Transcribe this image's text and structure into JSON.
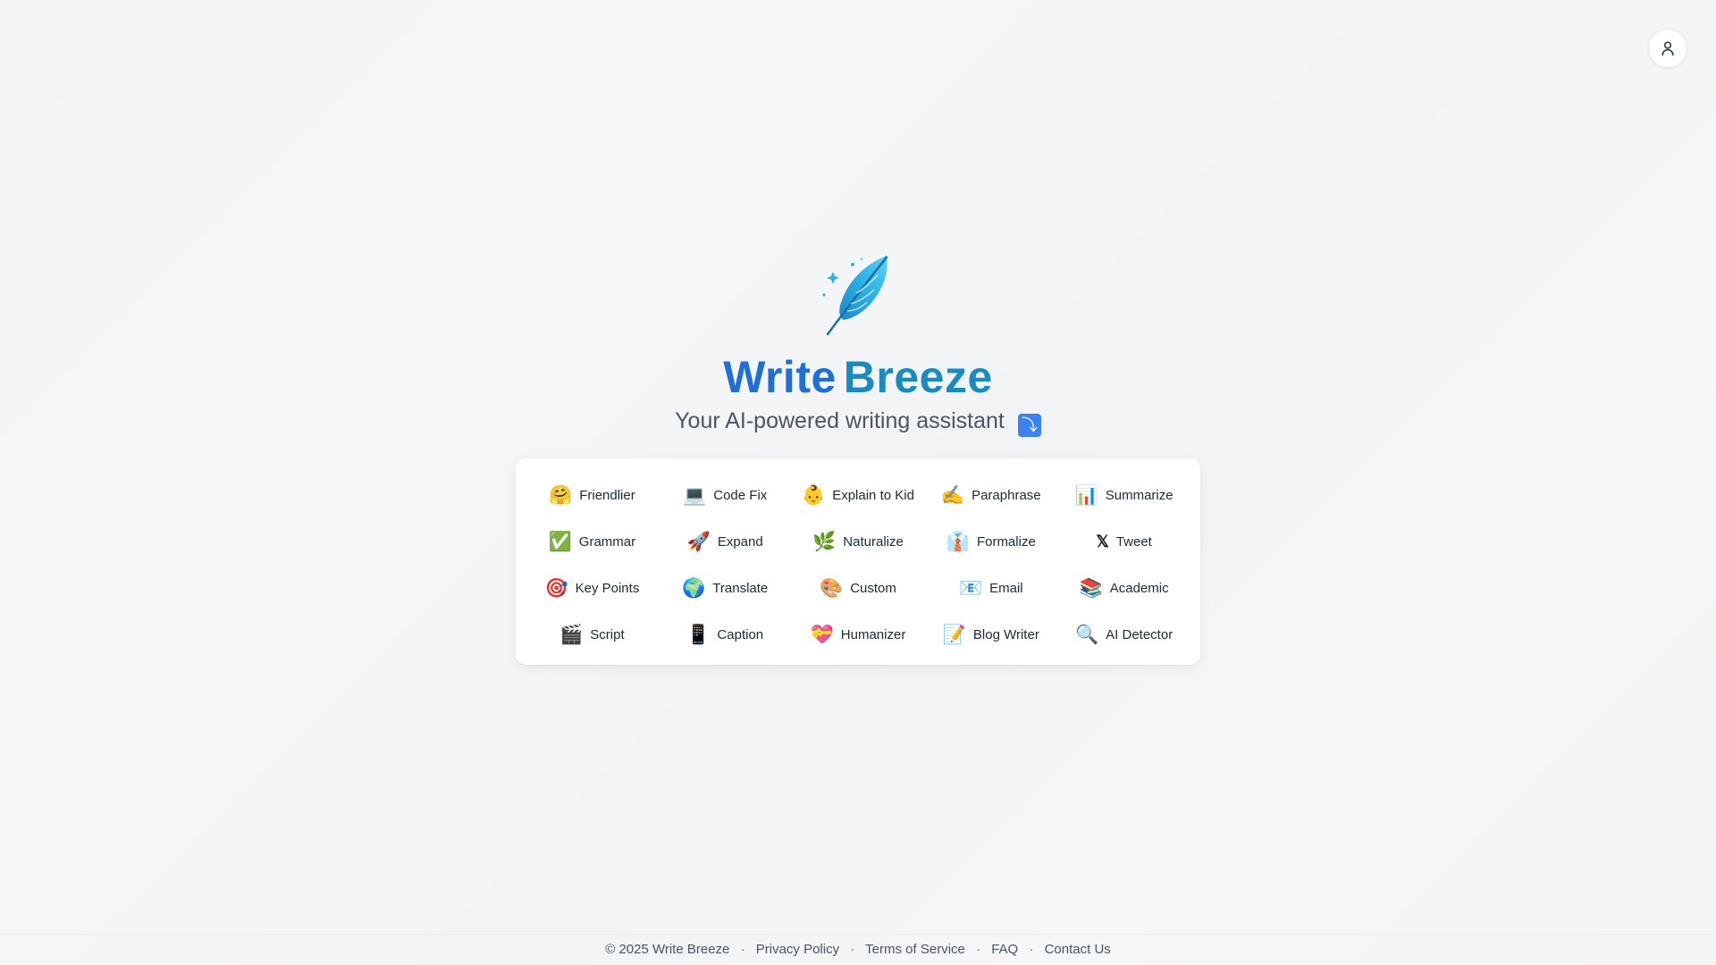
{
  "header": {
    "user_icon": "user-icon"
  },
  "brand": {
    "title_word1": "Write",
    "title_word2": "Breeze",
    "tagline": "Your AI-powered writing assistant",
    "tagline_icon": "arrow-curving-down-icon",
    "logo_icon": "feather-quill-icon",
    "title_colors": [
      "#1f6fd6",
      "#1a8bbf"
    ]
  },
  "tools": [
    {
      "label": "Friendlier",
      "emoji": "🤗",
      "icon": "hugging-face-icon"
    },
    {
      "label": "Code Fix",
      "emoji": "💻",
      "icon": "laptop-icon"
    },
    {
      "label": "Explain to Kid",
      "emoji": "👶",
      "icon": "baby-icon"
    },
    {
      "label": "Paraphrase",
      "emoji": "✍️",
      "icon": "writing-hand-icon"
    },
    {
      "label": "Summarize",
      "emoji": "📊",
      "icon": "bar-chart-icon"
    },
    {
      "label": "Grammar",
      "emoji": "✅",
      "icon": "check-mark-icon"
    },
    {
      "label": "Expand",
      "emoji": "🚀",
      "icon": "rocket-icon"
    },
    {
      "label": "Naturalize",
      "emoji": "🌿",
      "icon": "herb-icon"
    },
    {
      "label": "Formalize",
      "emoji": "👔",
      "icon": "necktie-icon"
    },
    {
      "label": "Tweet",
      "emoji": "𝕏",
      "icon": "x-logo-icon"
    },
    {
      "label": "Key Points",
      "emoji": "🎯",
      "icon": "target-icon"
    },
    {
      "label": "Translate",
      "emoji": "🌍",
      "icon": "globe-icon"
    },
    {
      "label": "Custom",
      "emoji": "🎨",
      "icon": "palette-icon"
    },
    {
      "label": "Email",
      "emoji": "📧",
      "icon": "email-icon"
    },
    {
      "label": "Academic",
      "emoji": "📚",
      "icon": "books-icon"
    },
    {
      "label": "Script",
      "emoji": "🎬",
      "icon": "clapper-board-icon"
    },
    {
      "label": "Caption",
      "emoji": "📱",
      "icon": "mobile-phone-icon"
    },
    {
      "label": "Humanizer",
      "emoji": "💝",
      "icon": "heart-ribbon-icon"
    },
    {
      "label": "Blog Writer",
      "emoji": "📝",
      "icon": "memo-icon"
    },
    {
      "label": "AI Detector",
      "emoji": "🔍",
      "icon": "magnifier-icon"
    }
  ],
  "footer": {
    "copyright": "© 2025 Write Breeze",
    "links": [
      "Privacy Policy",
      "Terms of Service",
      "FAQ",
      "Contact Us"
    ],
    "separator": "·"
  }
}
